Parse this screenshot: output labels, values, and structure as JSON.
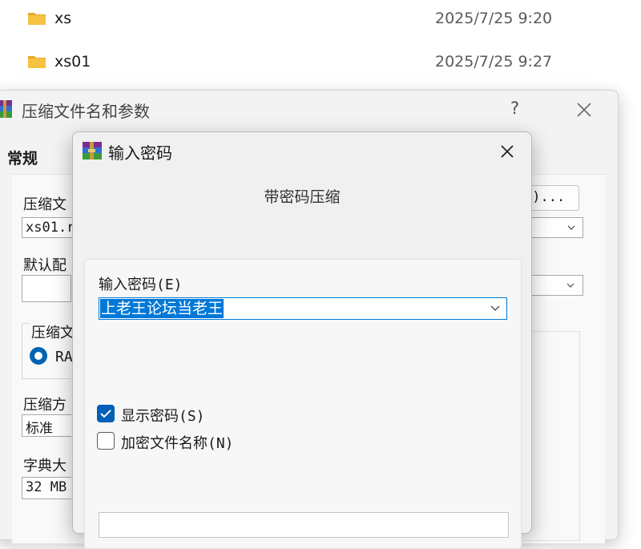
{
  "explorer": {
    "rows": [
      {
        "name": "xs",
        "modified": "2025/7/25 9:20"
      },
      {
        "name": "xs01",
        "modified": "2025/7/25 9:27"
      }
    ]
  },
  "archive_dialog": {
    "title": "压缩文件名和参数",
    "help_label": "?",
    "tab_general": "常规",
    "archive_name_label": "压缩文",
    "archive_name_value": "xs01.r",
    "browse_label": "B)...",
    "default_profile_label": "默认配",
    "format_group_label": "压缩文",
    "format_option": "RA",
    "method_label": "压缩方",
    "method_value": "标准",
    "dictionary_label": "字典大",
    "dictionary_value": "32 MB"
  },
  "password_dialog": {
    "title": "输入密码",
    "heading": "带密码压缩",
    "password_label": "输入密码(E)",
    "password_value": "上老王论坛当老王",
    "show_password_label": "显示密码(S)",
    "show_password_checked": true,
    "encrypt_names_label": "加密文件名称(N)",
    "encrypt_names_checked": false
  },
  "colors": {
    "accent": "#0078d7",
    "checkbox_checked": "#005fb8",
    "folder": "#f5c242"
  }
}
